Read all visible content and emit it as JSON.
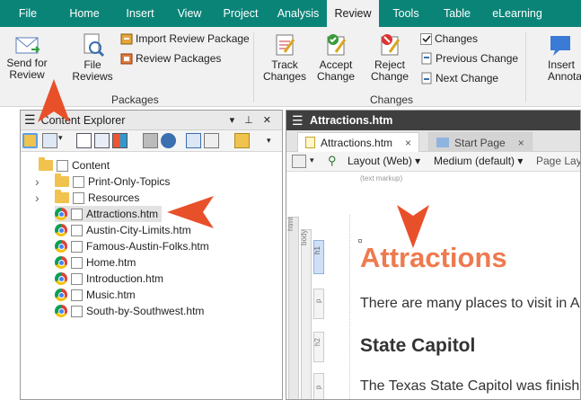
{
  "ribbon_tabs": [
    "File",
    "Home",
    "Insert",
    "View",
    "Project",
    "Analysis",
    "Review",
    "Tools",
    "Table",
    "eLearning"
  ],
  "active_tab": "Review",
  "ribbon": {
    "send_for_review": "Send for\nReview",
    "file_reviews": "File\nReviews",
    "import_review_package": "Import Review Package",
    "review_packages": "Review Packages",
    "packages_group": "Packages",
    "track_changes": "Track\nChanges",
    "accept_change": "Accept\nChange",
    "reject_change": "Reject\nChange",
    "changes_checkbox": "Changes",
    "previous_change": "Previous Change",
    "next_change": "Next Change",
    "changes_group": "Changes",
    "insert_annotation": "Insert\nAnnotation"
  },
  "content_explorer": {
    "title": "Content Explorer",
    "pin_glyph": "▾ ᵖ ✕",
    "tree": [
      {
        "label": "Content",
        "type": "folder",
        "level": 0,
        "expander": ""
      },
      {
        "label": "Print-Only-Topics",
        "type": "folder",
        "level": 1,
        "expander": "›"
      },
      {
        "label": "Resources",
        "type": "folder",
        "level": 1,
        "expander": "›"
      },
      {
        "label": "Attractions.htm",
        "type": "file",
        "level": 1,
        "expander": "",
        "selected": true
      },
      {
        "label": "Austin-City-Limits.htm",
        "type": "file",
        "level": 1,
        "expander": ""
      },
      {
        "label": "Famous-Austin-Folks.htm",
        "type": "file",
        "level": 1,
        "expander": ""
      },
      {
        "label": "Home.htm",
        "type": "file",
        "level": 1,
        "expander": ""
      },
      {
        "label": "Introduction.htm",
        "type": "file",
        "level": 1,
        "expander": ""
      },
      {
        "label": "Music.htm",
        "type": "file",
        "level": 1,
        "expander": ""
      },
      {
        "label": "South-by-Southwest.htm",
        "type": "file",
        "level": 1,
        "expander": ""
      }
    ]
  },
  "editor": {
    "title": "Attractions.htm",
    "tabs": [
      "Attractions.htm",
      "Start Page"
    ],
    "tab_close": "×",
    "layout": "Layout (Web)",
    "medium": "Medium (default)",
    "page_layout": "Page Layo",
    "text_markup": "(text markup)",
    "tag_html": "html",
    "tag_body": "body",
    "tag_h1": "h1",
    "tag_p": "p",
    "tag_h2": "h2",
    "heading": "Attractions",
    "para1": "There are many places to visit in A",
    "subheading": "State Capitol",
    "para2": "The Texas State Capitol was finish"
  },
  "colors": {
    "accent": "#0b8478",
    "arrow": "#e8502a",
    "heading": "#ee7a4f"
  }
}
